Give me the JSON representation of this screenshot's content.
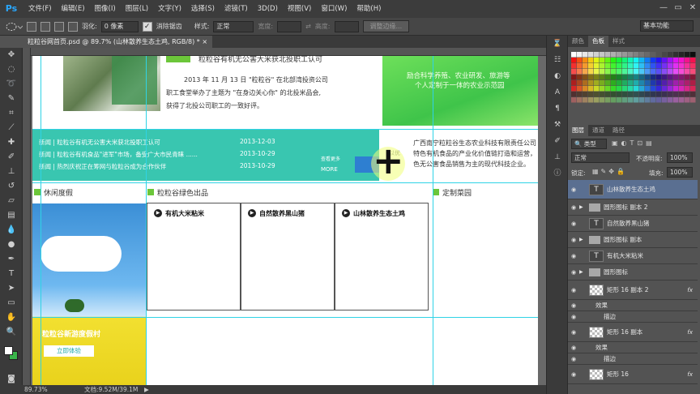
{
  "menubar": {
    "logo": "Ps",
    "items": [
      "文件(F)",
      "编辑(E)",
      "图像(I)",
      "图层(L)",
      "文字(Y)",
      "选择(S)",
      "滤镜(T)",
      "3D(D)",
      "视图(V)",
      "窗口(W)",
      "帮助(H)"
    ],
    "minimize": "—",
    "restore": "▭",
    "close": "✕"
  },
  "options": {
    "feather_label": "羽化:",
    "feather_value": "0 像素",
    "antialias_label": "消除锯齿",
    "style_label": "样式:",
    "style_value": "正常",
    "width_label": "宽度:",
    "height_label": "高度:",
    "refine_edge": "调整边缘...",
    "workspace": "基本功能"
  },
  "document": {
    "tab_title": "粒粒谷网首页.psd @ 89.7% (山林散养生态土鸡, RGB/8) *",
    "tab_close": "×"
  },
  "page": {
    "news_title": "粒粒谷有机无公害大米获北投职工认可",
    "news_body_1": "2013 年 11 月 13 日 \"粒粒谷\" 在北部湾投资公司",
    "news_body_2": "职工食堂举办了主题为 \"在身边关心你\" 的北投米品会,",
    "news_body_3": "获得了北投公司职工的一致好评。",
    "green_banner_1": "励合科学养殖、农业研发、旅游等",
    "green_banner_2": "个人定制于一体的农业示范园",
    "news_rows": [
      {
        "text": "新闻 | 粒粒谷有机无公害大米获北投职工认可",
        "date": "2013-12-03"
      },
      {
        "text": "新闻 | 粒粒谷有机食品\"进军\"市场，备受广大市民青睐 ......",
        "date": "2013-10-29"
      },
      {
        "text": "新闻 | 热烈庆祝正在筹网与粒粒谷成为合作伙伴",
        "date": "2013-10-29"
      }
    ],
    "more_cn": "查看更多",
    "more_en": "MORE",
    "company_1": "广西南宁粒粒谷生态农业科技有限责任公司",
    "company_2": "特色有机食品的产业化价值链打造和运营，",
    "company_3": "色无公害食品销售为主的现代科技企业。",
    "company_frag": "以优",
    "sec_leisure": "休闲度假",
    "sec_green": "粒粒谷绿色出品",
    "sec_custom": "定制菜园",
    "products": [
      "有机大米粘米",
      "自然散养黑山猪",
      "山林散养生态土鸡"
    ],
    "promo_text": "粒粒谷新游度假村",
    "promo_button": "立即体验",
    "crosshair": "+"
  },
  "status": {
    "zoom": "89.73%",
    "doc_info": "文档:9.52M/39.1M",
    "arrow": "▶"
  },
  "panels": {
    "top_tabs": [
      "颜色",
      "色板",
      "样式"
    ],
    "layer_tabs": [
      "图层",
      "通道",
      "路径"
    ],
    "kind_label": "类型",
    "blend_mode": "正常",
    "opacity_label": "不透明度:",
    "opacity_value": "100%",
    "lock_label": "锁定:",
    "fill_label": "填充:",
    "fill_value": "100%"
  },
  "layers": [
    {
      "name": "山林散养生态土鸡",
      "kind": "text"
    },
    {
      "name": "圆形图标 副本 2",
      "kind": "group"
    },
    {
      "name": "自然散养黑山猪",
      "kind": "text"
    },
    {
      "name": "圆形图标 副本",
      "kind": "group"
    },
    {
      "name": "有机大米粘米",
      "kind": "text"
    },
    {
      "name": "圆形图标",
      "kind": "group"
    },
    {
      "name": "矩形 16 副本 2",
      "kind": "shape"
    },
    {
      "name": "效果",
      "kind": "effect"
    },
    {
      "name": "描边",
      "kind": "effect"
    },
    {
      "name": "矩形 16 副本",
      "kind": "shape"
    },
    {
      "name": "效果",
      "kind": "effect"
    },
    {
      "name": "描边",
      "kind": "effect"
    },
    {
      "name": "矩形 16",
      "kind": "shape"
    }
  ],
  "colors": {
    "ps_blue": "#29a8ff",
    "teal_bar": "#39c6b0",
    "green_banner": "#5dd65a",
    "cyan_guide": "#2fd3e6",
    "selection_layer": "#5a6f91",
    "bullet_green": "#6cc63a"
  }
}
